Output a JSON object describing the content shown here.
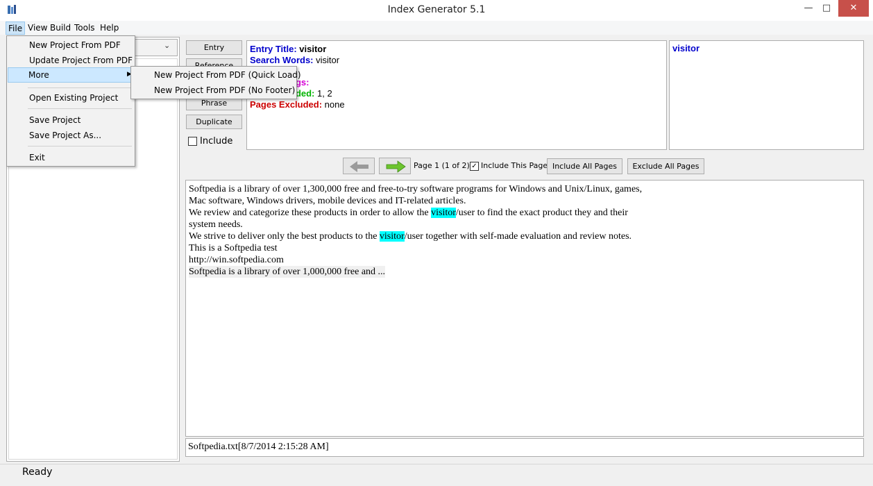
{
  "window": {
    "title": "Index Generator 5.1",
    "minimize": "—",
    "maximize": "□",
    "close": "✕"
  },
  "menubar": {
    "file": "File",
    "view": "View",
    "build": "Build",
    "tools": "Tools",
    "help": "Help"
  },
  "file_menu": {
    "new_project": "New Project From PDF",
    "update_project": "Update Project From PDF",
    "more": "More",
    "open_existing": "Open Existing Project",
    "save_project": "Save Project",
    "save_project_as": "Save Project As...",
    "exit": "Exit"
  },
  "more_submenu": {
    "quick_load": "New Project From PDF (Quick Load)",
    "no_footer": "New Project From PDF (No Footer)"
  },
  "entry_buttons": {
    "entry": "Entry",
    "reference": "Reference",
    "phrase": "Phrase",
    "duplicate": "Duplicate",
    "include": "Include"
  },
  "entry_info": {
    "title_key": "Entry Title:",
    "title_value": "visitor",
    "search_key": "Search Words:",
    "search_value": "visitor",
    "pages_key": "ngs:",
    "included_key": "uded:",
    "included_value": "1, 2",
    "excluded_key": "Pages Excluded:",
    "excluded_value": "none"
  },
  "right_panel": {
    "word": "visitor"
  },
  "navigation": {
    "page_label": "Page 1 (1 of 2)",
    "include_this_page": "Include This Page",
    "include_this_page_checked": true,
    "include_all": "Include All Pages",
    "exclude_all": "Exclude All Pages"
  },
  "text_content": {
    "line1": "Softpedia is a library of over 1,300,000 free and free-to-try software programs for Windows and Unix/Linux, games,",
    "line2": "Mac software, Windows drivers, mobile devices and IT-related articles.",
    "line3_a": "We review and categorize these products in order to allow the ",
    "line3_hl": "visitor",
    "line3_b": "/user to find the exact product they and their",
    "line4": "system needs.",
    "line5_a": "We strive to deliver only the best products to the ",
    "line5_hl": "visitor",
    "line5_b": "/user together with self-made evaluation and review notes.",
    "line6": "This is a Softpedia test",
    "line7": "http://win.softpedia.com",
    "line8": "Softpedia is a library of over 1,000,000 free and ..."
  },
  "file_info": "Softpedia.txt[8/7/2014 2:15:28 AM]",
  "status": "Ready",
  "colors": {
    "highlight": "#00ffff",
    "key_blue": "#0000cc",
    "key_green": "#00b400",
    "key_red": "#cc0000",
    "key_magenta": "#d400d4"
  }
}
